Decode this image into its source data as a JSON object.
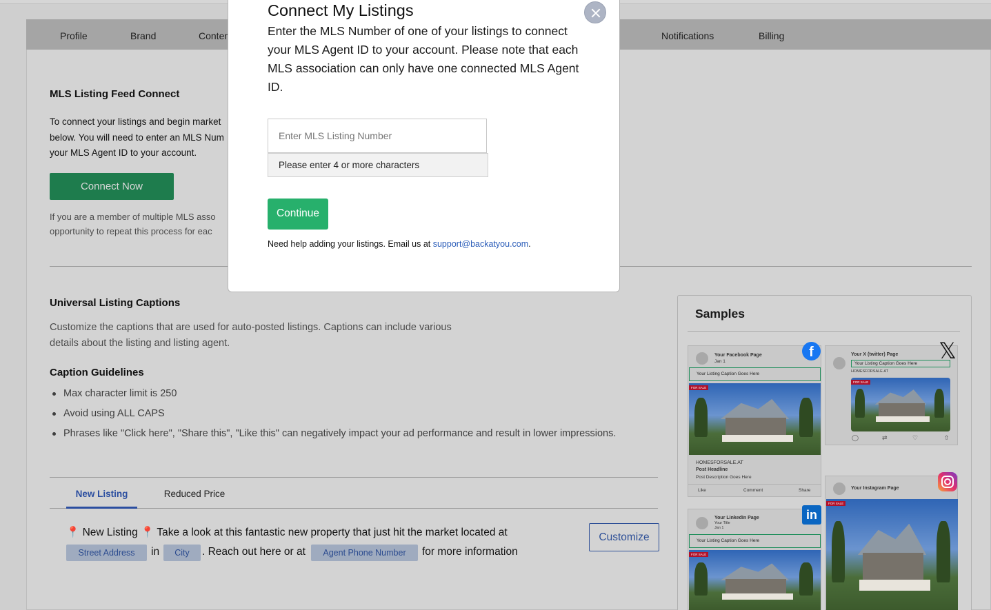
{
  "nav": {
    "tabs": [
      "Profile",
      "Brand",
      "Conten",
      "Notifications",
      "Billing"
    ]
  },
  "mls": {
    "heading": "MLS Listing Feed Connect",
    "body_lines": [
      "To connect your listings and begin market",
      "below. You will need to enter an MLS Num",
      "your MLS Agent ID to your account."
    ],
    "connect_label": "Connect Now",
    "note_lines": [
      "If you are a member of multiple MLS asso",
      "opportunity to repeat this process for eac"
    ]
  },
  "captions": {
    "heading": "Universal Listing Captions",
    "desc_lines": [
      "Customize the captions that are used for auto-posted listings. Captions can include various",
      "details about the listing and listing agent."
    ],
    "guidelines_heading": "Caption Guidelines",
    "guidelines": [
      "Max character limit is 250",
      "Avoid using ALL CAPS",
      "Phrases like \"Click here\", \"Share this\", \"Like this\" can negatively impact your ad performance and result in lower impressions."
    ],
    "tabs": {
      "new_listing": "New Listing",
      "reduced_price": "Reduced Price"
    },
    "caption_part1": "📍 New Listing 📍 Take a look at this fantastic new property that just hit the market located at",
    "chip_street": "Street Address",
    "word_in": "in",
    "chip_city": "City",
    "caption_part2": ". Reach out here or at",
    "chip_phone": "Agent Phone Number",
    "caption_part3": "for more information",
    "customize_label": "Customize"
  },
  "samples": {
    "title": "Samples",
    "facebook": {
      "page": "Your Facebook Page",
      "date": "Jan 1",
      "caption": "Your Listing Caption Goes Here",
      "site": "HOMESFORSALE.AT",
      "headline": "Post Headline",
      "desc": "Post Description Goes Here",
      "like": "Like",
      "comment": "Comment",
      "share": "Share",
      "badge": "FOR SALE"
    },
    "twitter": {
      "page": "Your X (twitter) Page",
      "caption": "Your Listing Caption Goes Here",
      "site": "HOMESFORSALE.AT",
      "badge": "FOR SALE"
    },
    "instagram": {
      "page": "Your Instagram Page",
      "badge": "FOR SALE"
    },
    "linkedin": {
      "page": "Your LinkedIn Page",
      "subtitle": "Your Title",
      "date": "Jan 1",
      "caption": "Your Listing Caption Goes Here",
      "badge": "FOR SALE"
    },
    "colors": {
      "facebook": "#1877f2",
      "linkedin": "#0a66c2",
      "accent_green": "#1e8e5a"
    }
  },
  "modal": {
    "title": "Connect My Listings",
    "description": "Enter the MLS Number of one of your listings to connect your MLS Agent ID to your account. Please note that each MLS association can only have one connected MLS Agent ID.",
    "input_placeholder": "Enter MLS Listing Number",
    "hint": "Please enter 4 or more characters",
    "continue_label": "Continue",
    "help_text": "Need help adding your listings. Email us at ",
    "help_email": "support@backatyou.com",
    "help_end": "."
  }
}
